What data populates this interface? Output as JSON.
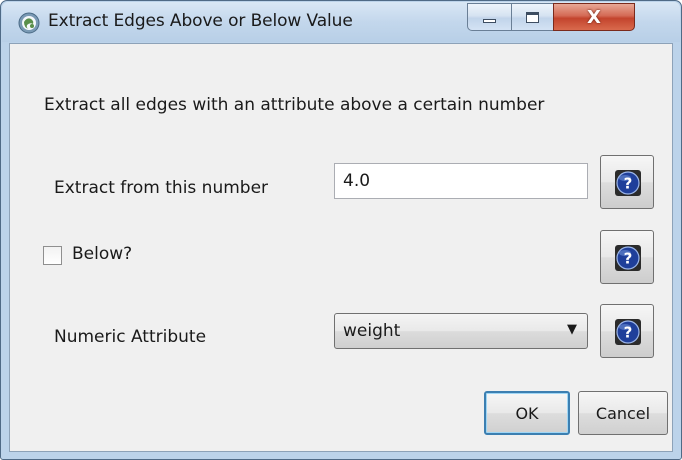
{
  "window": {
    "title": "Extract Edges Above or Below Value",
    "icon": "cytoscape-app-icon",
    "controls": {
      "minimize": "minimize-icon",
      "maximize": "maximize-icon",
      "close": "X"
    }
  },
  "dialog": {
    "description": "Extract all edges with an attribute above a certain number",
    "threshold": {
      "label": "Extract from this number",
      "value": "4.0",
      "help_icon": "help-question-icon"
    },
    "below": {
      "label": "Below?",
      "checked": false,
      "help_icon": "help-question-icon"
    },
    "attribute": {
      "label": "Numeric Attribute",
      "selected": "weight",
      "help_icon": "help-question-icon"
    },
    "buttons": {
      "ok": "OK",
      "cancel": "Cancel"
    }
  },
  "colors": {
    "frame": "#bcd3ea",
    "client_bg": "#f0f0f0",
    "close_button": "#c3442d",
    "help_icon_blue": "#1f3f9a",
    "default_button_border": "#3c7fb1"
  }
}
